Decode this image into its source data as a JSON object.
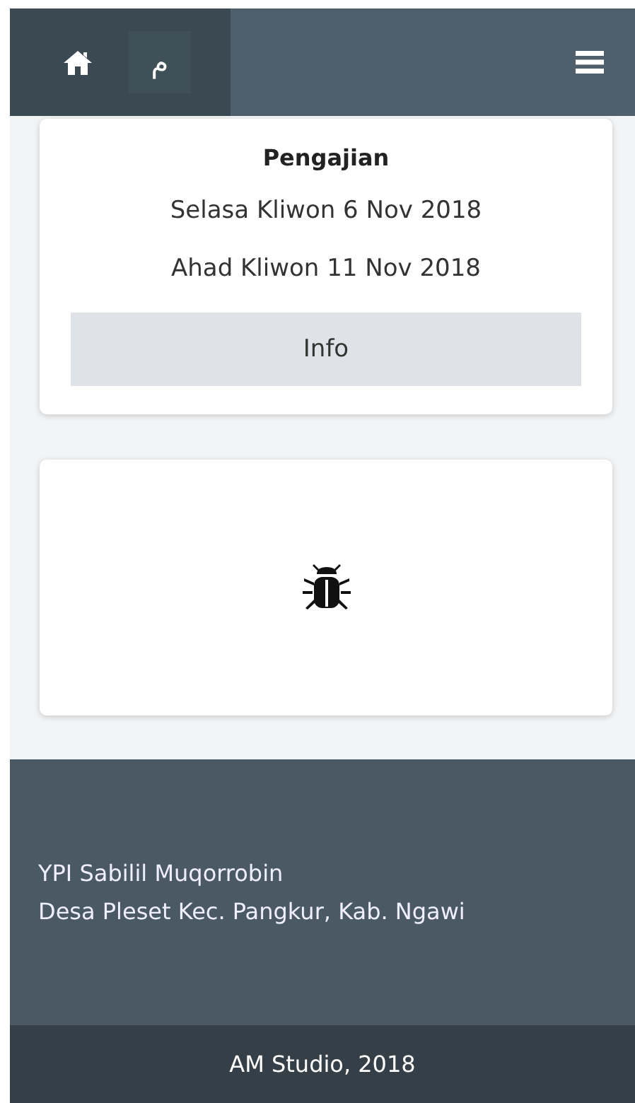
{
  "navbar": {
    "arabic_button": "م"
  },
  "event_card": {
    "title": "Pengajian",
    "dates": [
      "Selasa Kliwon 6 Nov 2018",
      "Ahad Kliwon 11 Nov 2018"
    ],
    "button": "Info"
  },
  "footer": {
    "lines": [
      "YPI Sabilil Muqorrobin",
      "Desa Pleset Kec. Pangkur, Kab. Ngawi"
    ],
    "copyright": "AM Studio, 2018"
  }
}
